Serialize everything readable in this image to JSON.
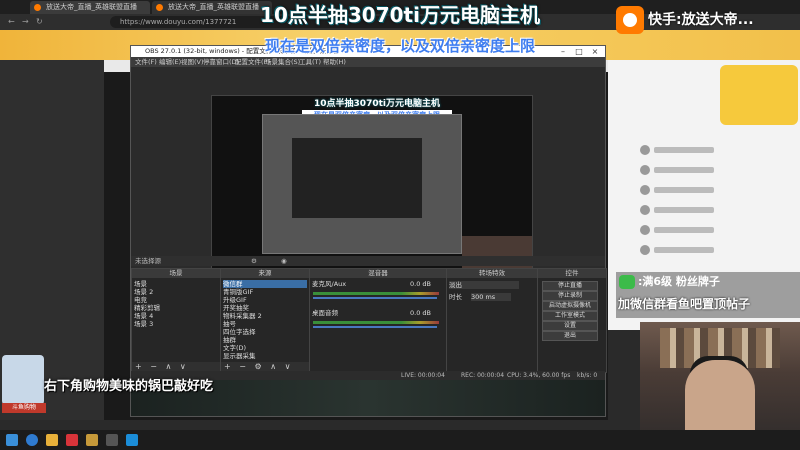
{
  "browser": {
    "tabs": [
      "放送大帝_直播_英雄联盟直播",
      "放送大帝_直播_英雄联盟直播"
    ],
    "url": "https://www.douyu.com/1377721"
  },
  "overlay": {
    "title_main": "10点半抽3070ti万元电脑主机",
    "title_sub": "现在是双倍亲密度，以及双倍亲密度上限",
    "kuaishou": "快手:放送大帝...",
    "wechat_line1": ":满6级 粉丝牌子",
    "wechat_line2": "加微信群看鱼吧置顶帖子",
    "promo": "右下角购物美味的锅巴敲好吃",
    "avatar_label": "斗鱼购物"
  },
  "obs": {
    "title": "OBS 27.0.1 (32-bit, windows) - 配置文件: 未命名 - 场景: 未命名",
    "menus": [
      "文件(F)",
      "编辑(E)",
      "视图(V)",
      "停靠窗口(D)",
      "配置文件(P)",
      "场景集合(S)",
      "工具(T)",
      "帮助(H)"
    ],
    "preview_title": "10点半抽3070ti万元电脑主机",
    "preview_sub": "现在是双倍亲密度，以及双倍亲密度上限",
    "scene_bar": "未选择源",
    "docks": {
      "scenes": {
        "title": "场景",
        "items": [
          "场景",
          "场景 2",
          "电竞",
          "精彩剪辑",
          "场景 4",
          "场景 3"
        ]
      },
      "sources": {
        "title": "来源",
        "items": [
          "微信群",
          "青铜版GIF",
          "升级GIF",
          "开奖抽奖",
          "物料采集器 2",
          "抽号",
          "四位字选择",
          "抽群",
          "文字(D)",
          "显示器采集"
        ]
      },
      "mixer": {
        "title": "混音器",
        "tracks": [
          "麦克风/Aux",
          "桌面音频"
        ],
        "db": [
          "0.0 dB",
          "0.0 dB"
        ]
      },
      "transitions": {
        "title": "转场特效",
        "type": "淡出",
        "duration_label": "时长",
        "duration": "300 ms"
      },
      "controls": {
        "title": "控件",
        "buttons": [
          "停止直播",
          "停止录制",
          "启动虚拟摄像机",
          "工作室模式",
          "设置",
          "退出"
        ]
      }
    },
    "status": {
      "live": "LIVE: 00:00:04",
      "rec": "REC: 00:00:04",
      "cpu": "CPU: 3.4%, 60.00 fps",
      "kbps": "kb/s: 0"
    }
  }
}
